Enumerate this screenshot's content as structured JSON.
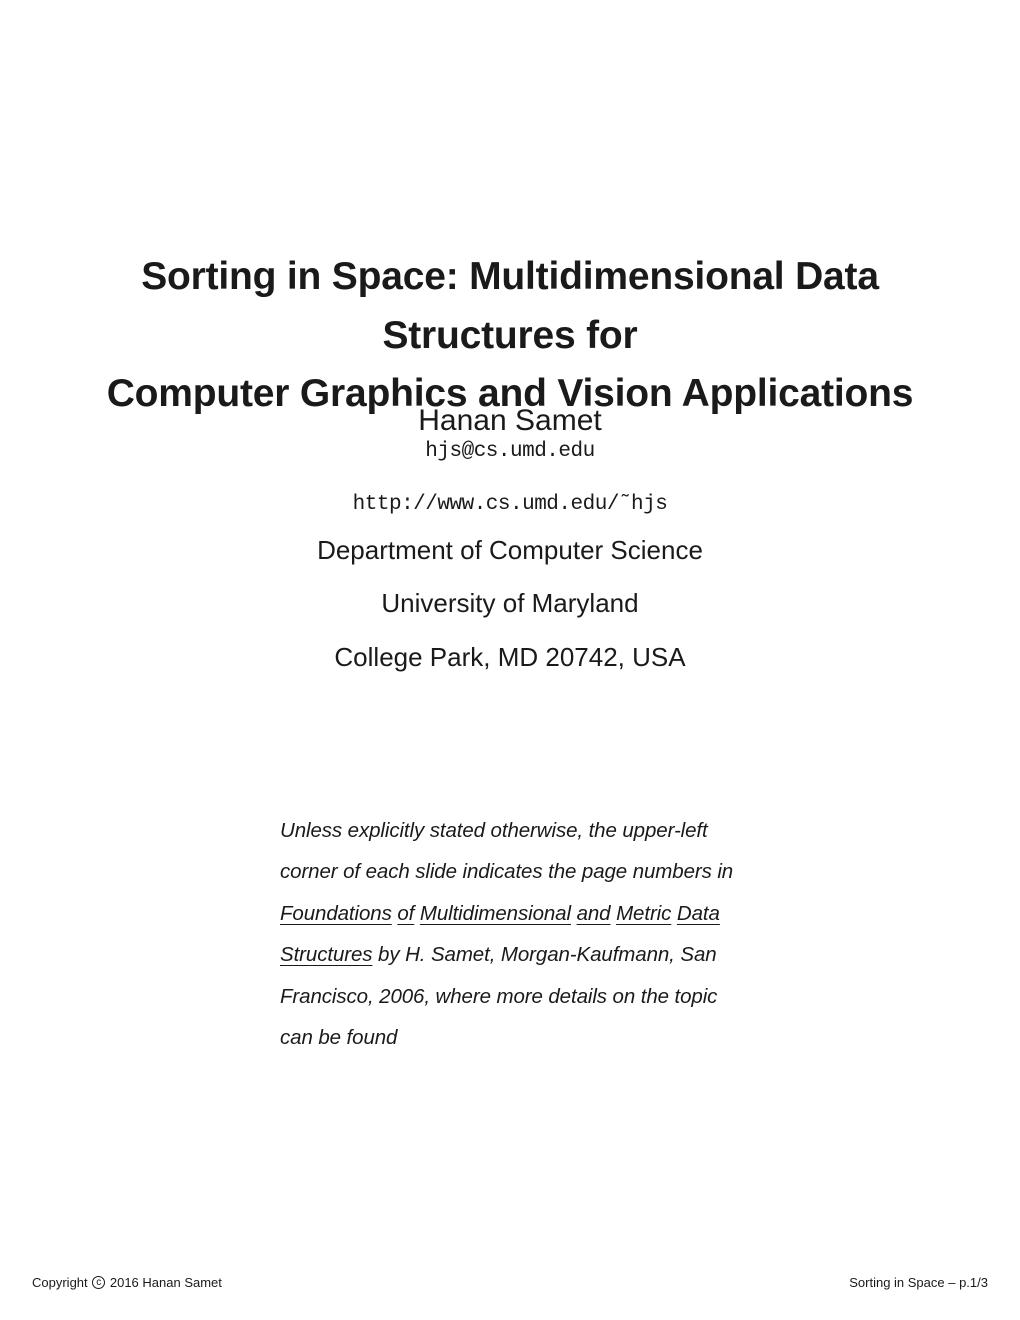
{
  "title": {
    "line1": "Sorting in Space: Multidimensional Data Structures for",
    "line2": "Computer Graphics and Vision Applications"
  },
  "author": {
    "name": "Hanan Samet",
    "email": "hjs@cs.umd.edu",
    "website": "http://www.cs.umd.edu/˜hjs",
    "department": "Department of Computer Science",
    "university": "University of Maryland",
    "location": "College Park, MD 20742, USA"
  },
  "note": {
    "prefix": "Unless explicitly stated otherwise, the upper-left corner of each slide indicates the page numbers in ",
    "book_w1": "Foundations",
    "book_sep1": " ",
    "book_w2": "of",
    "book_sep2": " ",
    "book_w3": "Multidimensional",
    "book_sep3": " ",
    "book_w4": "and",
    "book_sep4": " ",
    "book_w5": "Metric",
    "book_sep5": " ",
    "book_w6": "Data",
    "book_sep6": " ",
    "book_w7": "Structures",
    "suffix": " by H. Samet, Morgan-Kaufmann, San Francisco, 2006, where more details on the topic can be found"
  },
  "footer": {
    "copyright_pre": "Copyright ",
    "copyright_year_name": " 2016 Hanan Samet",
    "right": "Sorting in Space – p.1/3",
    "c_symbol": "c"
  }
}
